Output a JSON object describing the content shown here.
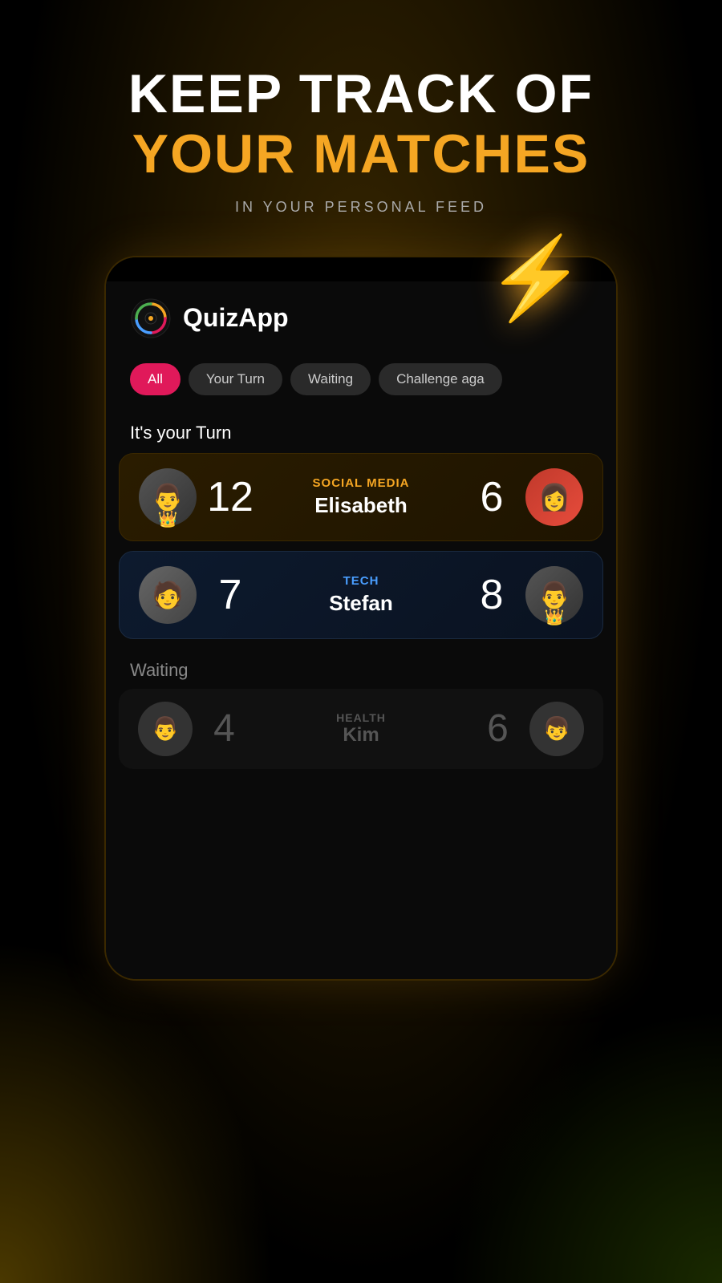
{
  "background": {
    "color": "#000000"
  },
  "header": {
    "line1": "KEEP TRACK OF",
    "line2": "YOUR MATCHES",
    "subtitle": "IN YOUR PERSONAL FEED"
  },
  "lightning": "⚡",
  "app": {
    "name": "QuizApp"
  },
  "filter_tabs": [
    {
      "label": "All",
      "active": true
    },
    {
      "label": "Your Turn",
      "active": false
    },
    {
      "label": "Waiting",
      "active": false
    },
    {
      "label": "Challenge aga",
      "active": false
    }
  ],
  "your_turn_label": "It's your Turn",
  "waiting_label": "Waiting",
  "matches_your_turn": [
    {
      "category": "SOCIAL MEDIA",
      "category_color": "orange",
      "opponent": "Elisabeth",
      "score_left": "12",
      "score_right": "6",
      "player_has_crown": true,
      "opponent_has_crown": false
    },
    {
      "category": "TECH",
      "category_color": "blue",
      "opponent": "Stefan",
      "score_left": "7",
      "score_right": "8",
      "player_has_crown": false,
      "opponent_has_crown": true
    }
  ],
  "matches_waiting": [
    {
      "category": "HEALTH",
      "category_color": "green",
      "opponent": "Kim",
      "score_left": "4",
      "score_right": "6",
      "player_has_crown": false,
      "opponent_has_crown": false
    }
  ]
}
